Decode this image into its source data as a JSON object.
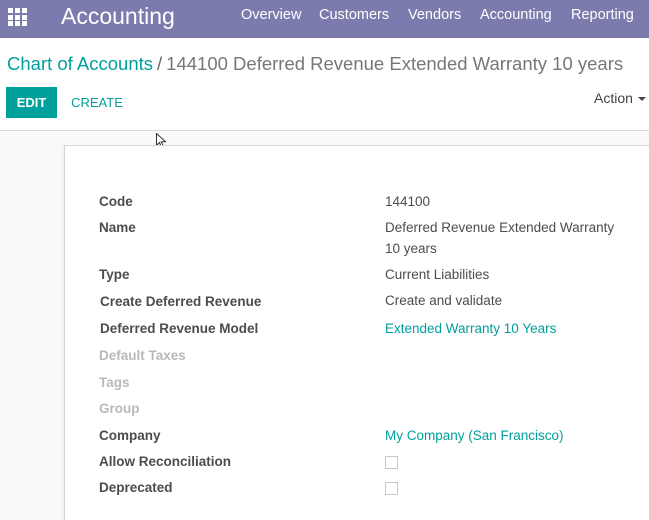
{
  "navbar": {
    "app_title": "Accounting",
    "menu": [
      "Overview",
      "Customers",
      "Vendors",
      "Accounting",
      "Reporting"
    ]
  },
  "breadcrumb": {
    "parent": "Chart of Accounts",
    "separator": "/",
    "current": "144100 Deferred Revenue Extended Warranty 10 years"
  },
  "buttons": {
    "edit": "EDIT",
    "create": "CREATE",
    "action": "Action"
  },
  "form": {
    "code": {
      "label": "Code",
      "value": "144100"
    },
    "name": {
      "label": "Name",
      "value": "Deferred Revenue Extended Warranty 10 years"
    },
    "type": {
      "label": "Type",
      "value": "Current Liabilities"
    },
    "deferred_rev": {
      "label": "Create Deferred Revenue",
      "value": "Create and validate"
    },
    "deferred_model": {
      "label": "Deferred Revenue Model",
      "value": "Extended Warranty 10 Years"
    },
    "default_taxes": {
      "label": "Default Taxes"
    },
    "tags": {
      "label": "Tags"
    },
    "group": {
      "label": "Group"
    },
    "company": {
      "label": "Company",
      "value": "My Company (San Francisco)"
    },
    "allow_reconciliation": {
      "label": "Allow Reconciliation",
      "checked": false
    },
    "deprecated": {
      "label": "Deprecated",
      "checked": false
    }
  },
  "colors": {
    "navbar": "#7c7bad",
    "accent": "#00a09d",
    "text": "#4c4c4c",
    "muted": "#b9b9b9"
  },
  "icons": {
    "apps": "apps-grid-icon",
    "cursor": "mouse-pointer-icon",
    "action_caret": "caret-down-icon"
  }
}
